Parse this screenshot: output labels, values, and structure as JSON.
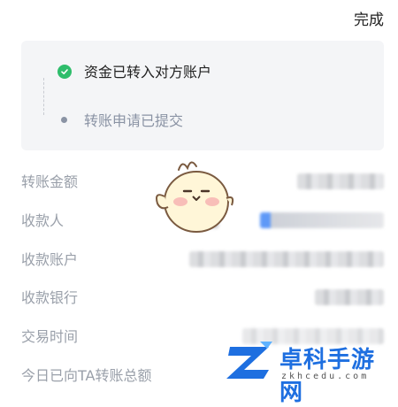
{
  "header": {
    "done_label": "完成"
  },
  "status": {
    "steps": [
      {
        "text": "资金已转入对方账户",
        "state": "done"
      },
      {
        "text": "转账申请已提交",
        "state": "pending"
      }
    ],
    "colors": {
      "success": "#2ebd6b",
      "muted": "#8a93a4"
    }
  },
  "details": {
    "rows": [
      {
        "label": "转账金额"
      },
      {
        "label": "收款人"
      },
      {
        "label": "收款账户"
      },
      {
        "label": "收款银行"
      },
      {
        "label": "交易时间"
      },
      {
        "label": "今日已向TA转账总额"
      }
    ]
  },
  "watermark": {
    "name": "卓科手游网",
    "url": "zkhcedu.com"
  },
  "mascot": {
    "icon": "chick-mascot-icon"
  }
}
